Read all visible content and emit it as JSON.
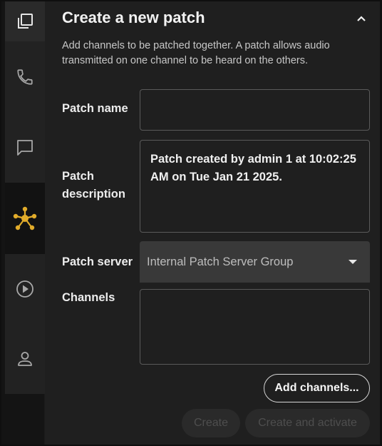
{
  "sidebar": {
    "items": [
      {
        "icon": "copy-window-icon"
      },
      {
        "icon": "phone-icon"
      },
      {
        "icon": "chat-icon"
      },
      {
        "icon": "patch-network-icon",
        "active": true,
        "accent": "#e2ac2a"
      },
      {
        "icon": "play-circle-icon"
      },
      {
        "icon": "user-icon"
      }
    ]
  },
  "panel": {
    "title": "Create a new patch",
    "description": "Add channels to be patched together. A patch allows audio transmitted on one channel to be heard on the others.",
    "fields": {
      "name_label": "Patch name",
      "name_value": "",
      "description_label": "Patch description",
      "description_value": "Patch created by admin 1 at 10:02:25 AM on Tue Jan 21 2025.",
      "server_label": "Patch server",
      "server_value": "Internal Patch Server Group",
      "channels_label": "Channels"
    },
    "buttons": {
      "add_channels": "Add channels...",
      "create": "Create",
      "create_and_activate": "Create and activate"
    }
  },
  "colors": {
    "accent": "#e2ac2a",
    "background": "#1f1f1f"
  }
}
